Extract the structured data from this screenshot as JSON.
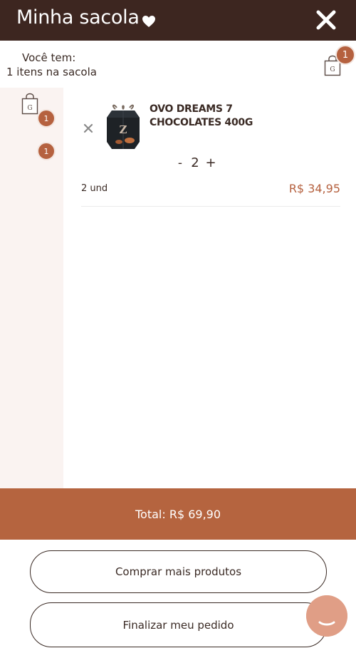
{
  "header": {
    "title": "Minha sacola",
    "heart_icon": "heart-icon",
    "close_icon": "close-icon",
    "background": "#3d2620"
  },
  "summary": {
    "line1": "Você tem:",
    "line2": "1 itens na sacola",
    "bag_icon": "shopping-bag-icon",
    "bag_count": "1"
  },
  "sidebar": {
    "bag_icon": "shopping-bag-icon",
    "badges": [
      "1",
      "1"
    ]
  },
  "cart": {
    "items": [
      {
        "name": "OVO DREAMS 7 CHOCOLATES 400G",
        "quantity": "2",
        "qty_minus": "-",
        "qty_plus": "+",
        "unit_label": "2 und",
        "price": "R$ 34,95",
        "remove_icon": "close-icon"
      }
    ]
  },
  "total": {
    "label": "Total: R$ 69,90"
  },
  "actions": {
    "more_label": "Comprar mais produtos",
    "finish_label": "Finalizar meu pedido"
  },
  "chat": {
    "icon": "chat-bubble-icon"
  },
  "colors": {
    "accent": "#b5643f",
    "dark": "#3d2620",
    "sidebar_bg": "#faf3f1"
  }
}
